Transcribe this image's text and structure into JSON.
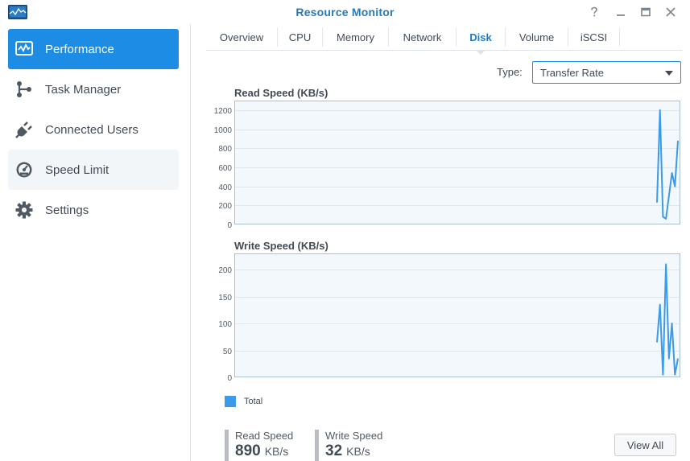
{
  "window": {
    "title": "Resource Monitor"
  },
  "sidebar": {
    "items": [
      {
        "label": "Performance",
        "icon": "performance-icon",
        "state": "active"
      },
      {
        "label": "Task Manager",
        "icon": "task-manager-icon",
        "state": "normal"
      },
      {
        "label": "Connected Users",
        "icon": "connected-users-icon",
        "state": "normal"
      },
      {
        "label": "Speed Limit",
        "icon": "speed-limit-icon",
        "state": "hover"
      },
      {
        "label": "Settings",
        "icon": "gear-icon",
        "state": "normal"
      }
    ]
  },
  "tabs": [
    {
      "label": "Overview",
      "active": false
    },
    {
      "label": "CPU",
      "active": false
    },
    {
      "label": "Memory",
      "active": false
    },
    {
      "label": "Network",
      "active": false
    },
    {
      "label": "Disk",
      "active": true
    },
    {
      "label": "Volume",
      "active": false
    },
    {
      "label": "iSCSI",
      "active": false
    }
  ],
  "type_selector": {
    "label": "Type:",
    "value": "Transfer Rate"
  },
  "chart_data": [
    {
      "type": "line",
      "title": "Read Speed (KB/s)",
      "ylim": [
        0,
        1300
      ],
      "yticks": [
        0,
        200,
        400,
        600,
        800,
        1000,
        1200
      ],
      "grid": true,
      "legend": "bottom-left",
      "series": [
        {
          "name": "Total",
          "color": "#3d9ae8",
          "values": [
            230,
            1200,
            80,
            60,
            300,
            540,
            400,
            880
          ]
        }
      ]
    },
    {
      "type": "line",
      "title": "Write Speed (KB/s)",
      "ylim": [
        0,
        230
      ],
      "yticks": [
        0,
        50,
        100,
        150,
        200
      ],
      "grid": true,
      "legend": "bottom-left",
      "series": [
        {
          "name": "Total",
          "color": "#3d9ae8",
          "values": [
            65,
            135,
            5,
            210,
            35,
            100,
            5,
            35
          ]
        }
      ]
    }
  ],
  "legend": {
    "label": "Total",
    "color": "#3d9ae8"
  },
  "stats": {
    "read": {
      "label": "Read Speed",
      "value": "890",
      "unit": "KB/s"
    },
    "write": {
      "label": "Write Speed",
      "value": "32",
      "unit": "KB/s"
    }
  },
  "buttons": {
    "view_all": "View All"
  },
  "colors": {
    "accent": "#1c8ce4",
    "title": "#2779b8",
    "line": "#3d9ae8",
    "plot_bg": "#f3f8fc"
  }
}
